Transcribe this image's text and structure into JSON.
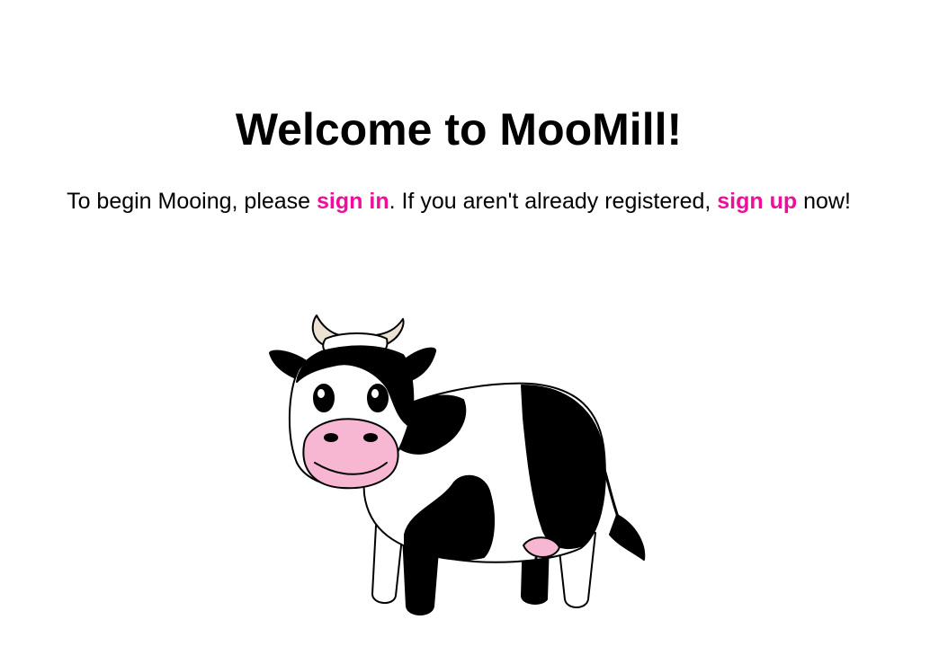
{
  "heading": "Welcome to MooMill!",
  "intro": {
    "text_before": "To begin Mooing, please ",
    "sign_in_label": "sign in",
    "text_middle": ". If you aren't already registered, ",
    "sign_up_label": "sign up",
    "text_after": " now!"
  },
  "colors": {
    "link": "#ee0e9c",
    "text": "#000000",
    "background": "#ffffff",
    "cow_nose": "#f7b6d2"
  },
  "illustration": {
    "icon": "cow-illustration"
  }
}
